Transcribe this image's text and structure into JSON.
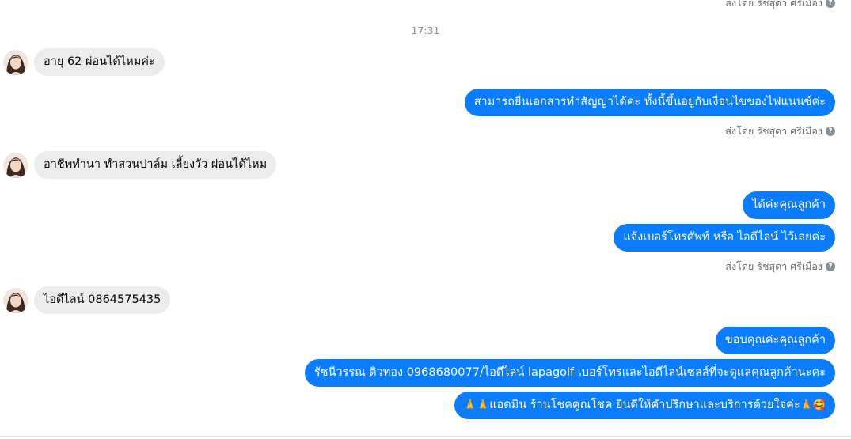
{
  "sent_by_label": "ส่งโดย รัชสุดา ศรีเมือง",
  "info_icon": "?",
  "timestamp": "17:31",
  "incoming": [
    {
      "text": "อายุ 62 ผ่อนได้ไหมค่ะ"
    },
    {
      "text": "อาชีพทำนา ทำสวนปาล์ม เลี้ยงวัว ผ่อนได้ไหม"
    },
    {
      "text": "ไอดีไลน์ 0864575435"
    }
  ],
  "outgoing": [
    {
      "text": "สามารถยื่นเอกสารทำสัญญาได้ค่ะ ทั้งนี้ขึ้นอยู่กับเงื่อนไขของไฟแนนซ์ค่ะ"
    },
    {
      "text": "ได้ค่ะคุณลูกค้า"
    },
    {
      "text": "แจ้งเบอร์โทรศัพท์ หรือ ไอดีไลน์  ไว้เลยค่ะ"
    },
    {
      "text": "ขอบคุณค่ะคุณลูกค้า"
    },
    {
      "text": "รัชนีวรรณ ติวทอง    0968680077/ไอดีไลน์ lapagolf  เบอร์โทรและไอดีไลน์เซลล์ที่จะดูแลคุณลูกค้านะคะ"
    },
    {
      "prefix": "🙏🙏",
      "text": "แอดมิน ร้านโชคคูณโชค ยินดีให้คำปรึกษาและบริการด้วยใจค่ะ",
      "suffix": "🙏🥰"
    }
  ],
  "icons": {
    "info": "info-circle-icon",
    "avatar": "user-avatar",
    "emoji_pray": "folded-hands-emoji",
    "emoji_love": "smiling-face-with-hearts-emoji"
  }
}
